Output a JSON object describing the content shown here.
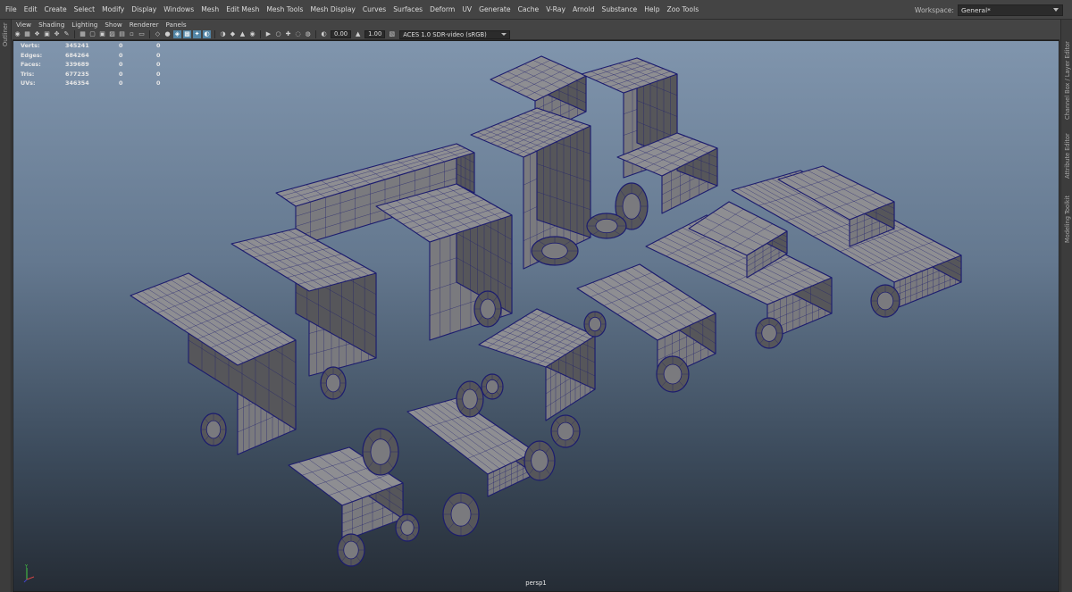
{
  "menubar": {
    "items": [
      "File",
      "Edit",
      "Create",
      "Select",
      "Modify",
      "Display",
      "Windows",
      "Mesh",
      "Edit Mesh",
      "Mesh Tools",
      "Mesh Display",
      "Curves",
      "Surfaces",
      "Deform",
      "UV",
      "Generate",
      "Cache",
      "V-Ray",
      "Arnold",
      "Substance",
      "Help",
      "Zoo Tools"
    ],
    "workspace_label": "Workspace:",
    "workspace_value": "General*"
  },
  "left_strip": {
    "outliner_tab": "Outliner"
  },
  "right_strip": {
    "tabs": [
      "Channel Box / Layer Editor",
      "Attribute Editor",
      "Modeling Toolkit"
    ]
  },
  "panel_menu": {
    "items": [
      "View",
      "Shading",
      "Lighting",
      "Show",
      "Renderer",
      "Panels"
    ]
  },
  "panel_toolbar": {
    "icons": [
      "camera-select-icon",
      "camera-attributes-icon",
      "bookmark-icon",
      "image-plane-icon",
      "2d-pan-icon",
      "grease-pencil-icon",
      "grid-icon",
      "film-gate-icon",
      "resolution-gate-icon",
      "gate-mask-icon",
      "field-chart-icon",
      "safe-action-icon",
      "safe-title-icon",
      "wireframe-icon",
      "smooth-shade-icon",
      "wireframe-on-shaded-icon",
      "textured-icon",
      "use-lights-icon",
      "shadows-icon",
      "screen-space-ao-icon",
      "motion-blur-icon",
      "anti-aliasing-icon",
      "depth-of-field-icon",
      "isolate-select-icon",
      "xray-icon",
      "xray-joints-icon",
      "xray-active-icon",
      "backface-culling-icon"
    ],
    "exposure_value": "0.00",
    "gamma_value": "1.00",
    "colorspace_value": "ACES 1.0 SDR-video (sRGB)"
  },
  "hud": {
    "rows": [
      {
        "label": "Verts:",
        "v1": "345241",
        "v2": "0",
        "v3": "0"
      },
      {
        "label": "Edges:",
        "v1": "684264",
        "v2": "0",
        "v3": "0"
      },
      {
        "label": "Faces:",
        "v1": "339689",
        "v2": "0",
        "v3": "0"
      },
      {
        "label": "Tris:",
        "v1": "677235",
        "v2": "0",
        "v3": "0"
      },
      {
        "label": "UVs:",
        "v1": "346354",
        "v2": "0",
        "v3": "0"
      }
    ]
  },
  "viewport": {
    "camera_name": "persp1",
    "model_colors": {
      "fill": "#7a7a7e",
      "wire": "#1c1c6e",
      "top": "#8e8e92",
      "dark": "#56565a"
    }
  }
}
